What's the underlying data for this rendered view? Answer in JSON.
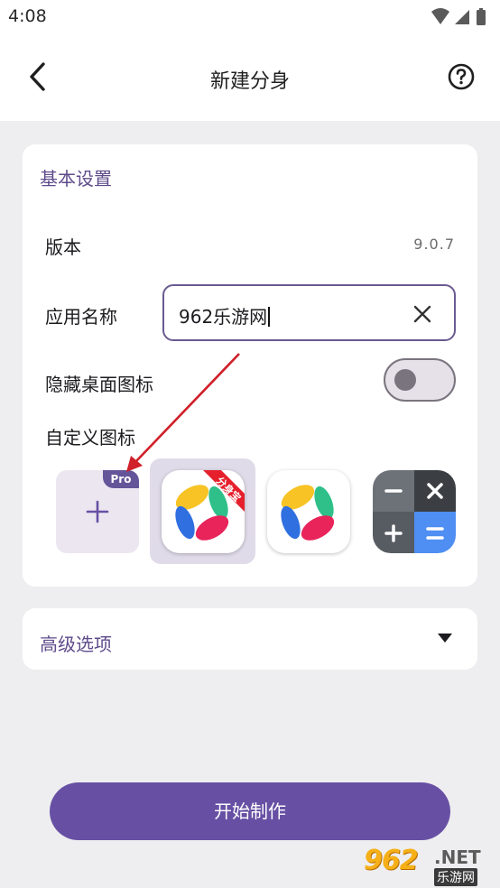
{
  "status_bar": {
    "time": "4:08",
    "icons": [
      "wifi-icon",
      "signal-icon",
      "battery-icon"
    ]
  },
  "header": {
    "title": "新建分身",
    "back_icon": "chevron-left-icon",
    "help_icon": "help-circle-icon"
  },
  "basic_settings": {
    "title": "基本设置",
    "version_label": "版本",
    "version_value": "9.0.7",
    "app_name_label": "应用名称",
    "app_name_value": "962乐游网",
    "hide_icon_label": "隐藏桌面图标",
    "hide_icon_enabled": false,
    "custom_icon_label": "自定义图标",
    "pro_badge": "Pro",
    "icon_options": [
      "add-custom-icon",
      "app-icon-with-ribbon",
      "app-icon-original",
      "calculator-icon"
    ],
    "ribbon_text": "分身宝",
    "selected_icon": "app-icon-with-ribbon"
  },
  "advanced": {
    "title": "高级选项",
    "arrow_icon": "caret-down-icon"
  },
  "action": {
    "start_label": "开始制作"
  },
  "watermark": {
    "number": "962",
    "domain": ".NET",
    "subtitle": "乐游网"
  },
  "colors": {
    "accent": "#6750a4",
    "section_title": "#5f4b8b",
    "background": "#eeeef0",
    "card": "#ffffff",
    "annotation_arrow": "#d0202a"
  }
}
